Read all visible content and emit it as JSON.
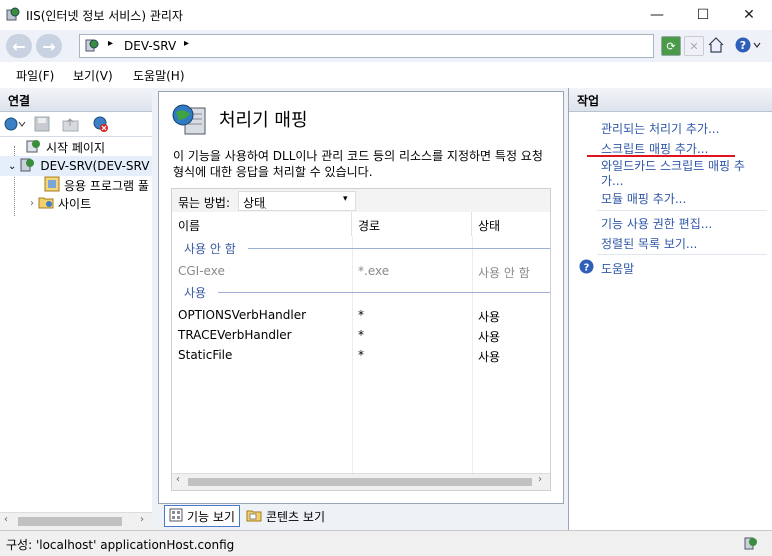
{
  "window": {
    "title": "IIS(인터넷 정보 서비스) 관리자",
    "minimize_glyph": "—",
    "maximize_glyph": "☐",
    "close_glyph": "✕"
  },
  "address": {
    "path": "DEV-SRV",
    "separator": "▸",
    "back_glyph": "←",
    "forward_glyph": "→"
  },
  "menu": [
    "파일(F)",
    "보기(V)",
    "도움말(H)"
  ],
  "connections": {
    "header": "연결",
    "tree": {
      "start_page": "시작 페이지",
      "server": "DEV-SRV(DEV-SRV",
      "app_pools": "응용 프로그램 풀",
      "sites": "사이트"
    }
  },
  "center": {
    "title": "처리기 매핑",
    "description": "이 기능을 사용하여 DLL이나 관리 코드 등의 리소스를 지정하면 특정 요청 형식에 대한 응답을 처리할 수 있습니다.",
    "group_by_label": "묶는 방법:",
    "group_by_value": "상태",
    "columns": [
      "이름",
      "경로",
      "상태"
    ],
    "groups": [
      {
        "label": "사용 안 함",
        "rows": [
          {
            "name": "CGI-exe",
            "path": "*.exe",
            "state": "사용 안 함"
          }
        ]
      },
      {
        "label": "사용",
        "rows": [
          {
            "name": "OPTIONSVerbHandler",
            "path": "*",
            "state": "사용"
          },
          {
            "name": "TRACEVerbHandler",
            "path": "*",
            "state": "사용"
          },
          {
            "name": "StaticFile",
            "path": "*",
            "state": "사용"
          }
        ]
      }
    ],
    "view_tabs": [
      "기능 보기",
      "콘텐츠 보기"
    ]
  },
  "actions": {
    "header": "작업",
    "items": [
      "관리되는 처리기 추가...",
      "스크립트 매핑 추가...",
      "와일드카드 스크립트 매핑 추",
      "가...",
      "모듈 매핑 추가...",
      "기능 사용 권한 편집...",
      "정렬된 목록 보기...",
      "도움말"
    ]
  },
  "status": {
    "text": "구성: 'localhost' applicationHost.config"
  },
  "colors": {
    "link": "#2f57a8",
    "group_label": "#3b5aa4",
    "annotation_underline": "#e0141e"
  }
}
